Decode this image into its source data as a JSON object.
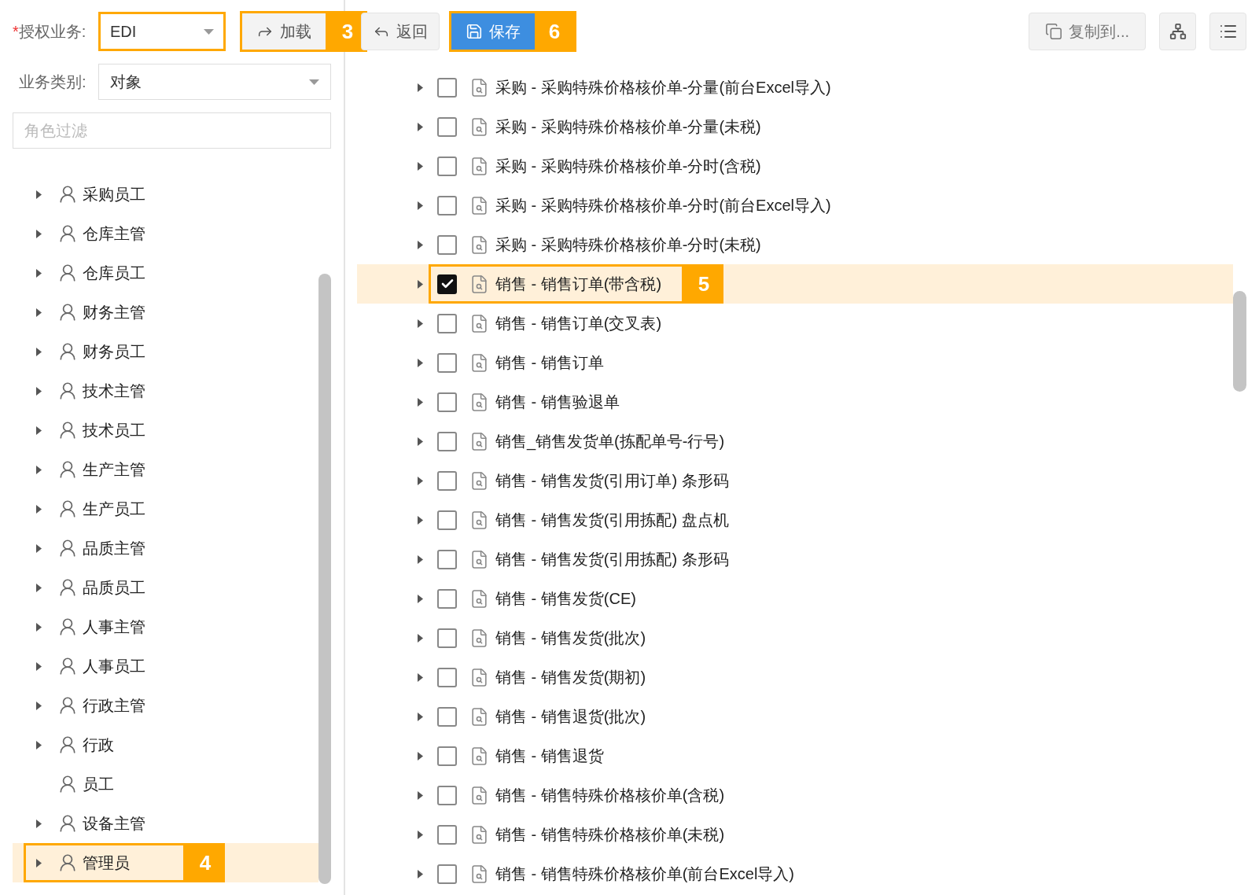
{
  "toolbar": {
    "business_label": "授权业务:",
    "required_mark": "*",
    "business_select": {
      "value": "EDI",
      "highlighted": true
    },
    "load_button": {
      "label": "加载",
      "callout": "3"
    },
    "back_button": {
      "label": "返回"
    },
    "save_button": {
      "label": "保存",
      "callout": "6"
    },
    "copy_button": {
      "label": "复制到..."
    }
  },
  "category": {
    "label": "业务类别:",
    "value": "对象"
  },
  "role_filter": {
    "placeholder": "角色过滤"
  },
  "roles": [
    {
      "label": "采购员工",
      "expandable": true,
      "selected": false
    },
    {
      "label": "仓库主管",
      "expandable": true,
      "selected": false
    },
    {
      "label": "仓库员工",
      "expandable": true,
      "selected": false
    },
    {
      "label": "财务主管",
      "expandable": true,
      "selected": false
    },
    {
      "label": "财务员工",
      "expandable": true,
      "selected": false
    },
    {
      "label": "技术主管",
      "expandable": true,
      "selected": false
    },
    {
      "label": "技术员工",
      "expandable": true,
      "selected": false
    },
    {
      "label": "生产主管",
      "expandable": true,
      "selected": false
    },
    {
      "label": "生产员工",
      "expandable": true,
      "selected": false
    },
    {
      "label": "品质主管",
      "expandable": true,
      "selected": false
    },
    {
      "label": "品质员工",
      "expandable": true,
      "selected": false
    },
    {
      "label": "人事主管",
      "expandable": true,
      "selected": false
    },
    {
      "label": "人事员工",
      "expandable": true,
      "selected": false
    },
    {
      "label": "行政主管",
      "expandable": true,
      "selected": false
    },
    {
      "label": "行政",
      "expandable": true,
      "selected": false
    },
    {
      "label": "员工",
      "expandable": false,
      "selected": false
    },
    {
      "label": "设备主管",
      "expandable": true,
      "selected": false
    },
    {
      "label": "管理员",
      "expandable": true,
      "selected": true,
      "callout": "4"
    }
  ],
  "objects": [
    {
      "label": "采购 - 采购特殊价格核价单-分量(前台Excel导入)",
      "checked": false,
      "selected": false
    },
    {
      "label": "采购 - 采购特殊价格核价单-分量(未税)",
      "checked": false,
      "selected": false
    },
    {
      "label": "采购 - 采购特殊价格核价单-分时(含税)",
      "checked": false,
      "selected": false
    },
    {
      "label": "采购 - 采购特殊价格核价单-分时(前台Excel导入)",
      "checked": false,
      "selected": false
    },
    {
      "label": "采购 - 采购特殊价格核价单-分时(未税)",
      "checked": false,
      "selected": false
    },
    {
      "label": "销售 - 销售订单(带含税)",
      "checked": true,
      "selected": true,
      "callout": "5"
    },
    {
      "label": "销售 - 销售订单(交叉表)",
      "checked": false,
      "selected": false
    },
    {
      "label": "销售 - 销售订单",
      "checked": false,
      "selected": false
    },
    {
      "label": "销售 - 销售验退单",
      "checked": false,
      "selected": false
    },
    {
      "label": "销售_销售发货单(拣配单号-行号)",
      "checked": false,
      "selected": false
    },
    {
      "label": "销售 - 销售发货(引用订单) 条形码",
      "checked": false,
      "selected": false
    },
    {
      "label": "销售 - 销售发货(引用拣配) 盘点机",
      "checked": false,
      "selected": false
    },
    {
      "label": "销售 - 销售发货(引用拣配) 条形码",
      "checked": false,
      "selected": false
    },
    {
      "label": "销售 - 销售发货(CE)",
      "checked": false,
      "selected": false
    },
    {
      "label": "销售 - 销售发货(批次)",
      "checked": false,
      "selected": false
    },
    {
      "label": "销售 - 销售发货(期初)",
      "checked": false,
      "selected": false
    },
    {
      "label": "销售 - 销售退货(批次)",
      "checked": false,
      "selected": false
    },
    {
      "label": "销售 - 销售退货",
      "checked": false,
      "selected": false
    },
    {
      "label": "销售 - 销售特殊价格核价单(含税)",
      "checked": false,
      "selected": false
    },
    {
      "label": "销售 - 销售特殊价格核价单(未税)",
      "checked": false,
      "selected": false
    },
    {
      "label": "销售 - 销售特殊价格核价单(前台Excel导入)",
      "checked": false,
      "selected": false
    }
  ]
}
